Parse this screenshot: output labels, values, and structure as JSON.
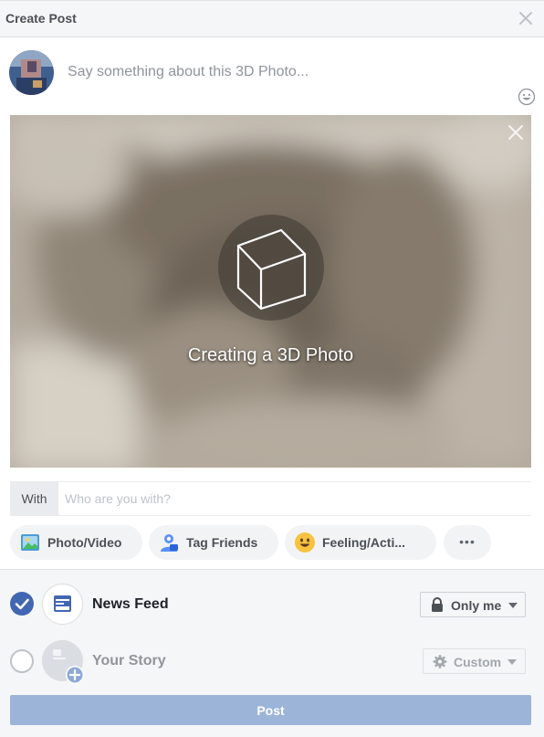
{
  "dialog": {
    "title": "Create Post"
  },
  "composer": {
    "placeholder": "Say something about this 3D Photo..."
  },
  "media": {
    "processing_label": "Creating a 3D Photo"
  },
  "with_row": {
    "label": "With",
    "placeholder": "Who are you with?"
  },
  "actions": [
    {
      "label": "Photo/Video",
      "icon": "photo-video-icon"
    },
    {
      "label": "Tag Friends",
      "icon": "tag-friends-icon"
    },
    {
      "label": "Feeling/Acti...",
      "icon": "feeling-emoji-icon"
    },
    {
      "label": "•••",
      "icon": "more-icon"
    }
  ],
  "destinations": [
    {
      "label": "News Feed",
      "checked": true,
      "privacy": "Only me",
      "privacy_icon": "lock-icon"
    },
    {
      "label": "Your Story",
      "checked": false,
      "privacy": "Custom",
      "privacy_icon": "gear-icon"
    }
  ],
  "post_button": {
    "label": "Post"
  },
  "colors": {
    "accent": "#4267b2",
    "post_disabled": "#9cb4d8",
    "chrome_bg": "#f5f6f7",
    "text_muted": "#90949c"
  }
}
